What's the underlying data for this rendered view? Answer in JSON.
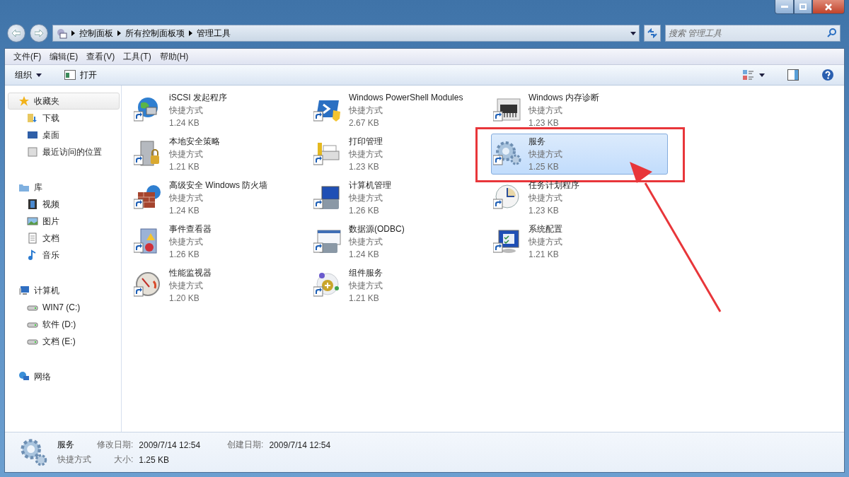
{
  "breadcrumb": [
    "控制面板",
    "所有控制面板项",
    "管理工具"
  ],
  "search": {
    "placeholder": "搜索 管理工具"
  },
  "menu": [
    "文件(F)",
    "编辑(E)",
    "查看(V)",
    "工具(T)",
    "帮助(H)"
  ],
  "toolbar": {
    "organize": "组织",
    "open": "打开"
  },
  "sidebar": [
    {
      "label": "收藏夹",
      "selected": true,
      "children": [
        {
          "label": "下载",
          "selected": false
        },
        {
          "label": "桌面",
          "selected": false
        },
        {
          "label": "最近访问的位置",
          "selected": false
        }
      ]
    },
    {
      "label": "库",
      "selected": false,
      "children": [
        {
          "label": "视频",
          "selected": false
        },
        {
          "label": "图片",
          "selected": false
        },
        {
          "label": "文档",
          "selected": false
        },
        {
          "label": "音乐",
          "selected": false
        }
      ]
    },
    {
      "label": "计算机",
      "selected": false,
      "children": [
        {
          "label": "WIN7 (C:)",
          "selected": false
        },
        {
          "label": "软件 (D:)",
          "selected": false
        },
        {
          "label": "文档 (E:)",
          "selected": false
        }
      ]
    },
    {
      "label": "网络",
      "selected": false
    }
  ],
  "items": [
    {
      "name": "iSCSI 发起程序",
      "type": "快捷方式",
      "size": "1.24 KB",
      "selected": false,
      "annotated": false
    },
    {
      "name": "Windows PowerShell Modules",
      "type": "快捷方式",
      "size": "2.67 KB",
      "selected": false,
      "annotated": false
    },
    {
      "name": "Windows 内存诊断",
      "type": "快捷方式",
      "size": "1.23 KB",
      "selected": false,
      "annotated": false
    },
    {
      "name": "本地安全策略",
      "type": "快捷方式",
      "size": "1.21 KB",
      "selected": false,
      "annotated": false
    },
    {
      "name": "打印管理",
      "type": "快捷方式",
      "size": "1.23 KB",
      "selected": false,
      "annotated": false
    },
    {
      "name": "服务",
      "type": "快捷方式",
      "size": "1.25 KB",
      "selected": true,
      "annotated": true
    },
    {
      "name": "高级安全 Windows 防火墙",
      "type": "快捷方式",
      "size": "1.24 KB",
      "selected": false,
      "annotated": false
    },
    {
      "name": "计算机管理",
      "type": "快捷方式",
      "size": "1.26 KB",
      "selected": false,
      "annotated": false
    },
    {
      "name": "任务计划程序",
      "type": "快捷方式",
      "size": "1.23 KB",
      "selected": false,
      "annotated": false
    },
    {
      "name": "事件查看器",
      "type": "快捷方式",
      "size": "1.26 KB",
      "selected": false,
      "annotated": false
    },
    {
      "name": "数据源(ODBC)",
      "type": "快捷方式",
      "size": "1.24 KB",
      "selected": false,
      "annotated": false
    },
    {
      "name": "系统配置",
      "type": "快捷方式",
      "size": "1.21 KB",
      "selected": false,
      "annotated": false
    },
    {
      "name": "性能监视器",
      "type": "快捷方式",
      "size": "1.20 KB",
      "selected": false,
      "annotated": false
    },
    {
      "name": "组件服务",
      "type": "快捷方式",
      "size": "1.21 KB",
      "selected": false,
      "annotated": false
    }
  ],
  "details": {
    "name": "服务",
    "type": "快捷方式",
    "modified_label": "修改日期:",
    "modified": "2009/7/14 12:54",
    "created_label": "创建日期:",
    "created": "2009/7/14 12:54",
    "size_label": "大小:",
    "size": "1.25 KB"
  }
}
